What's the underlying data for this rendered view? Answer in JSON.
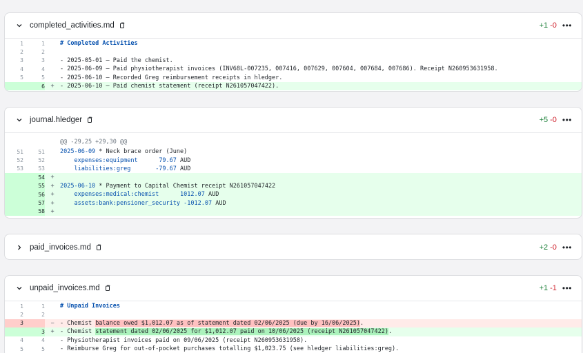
{
  "files": [
    {
      "name": "completed_activities.md",
      "additions": "+1",
      "deletions": "-0",
      "expanded": true,
      "lines": [
        {
          "old": "1",
          "new": "1",
          "sign": "",
          "type": "ctx",
          "text": "# Completed Activities"
        },
        {
          "old": "2",
          "new": "2",
          "sign": "",
          "type": "ctx",
          "text": ""
        },
        {
          "old": "3",
          "new": "3",
          "sign": "",
          "type": "ctx",
          "text": "- 2025-05-01 – Paid the chemist."
        },
        {
          "old": "4",
          "new": "4",
          "sign": "",
          "type": "ctx",
          "text": "- 2025-06-09 – Paid physiotherapist invoices (INV68L-007235, 007416, 007629, 007604, 007684, 007686). Receipt N260953631958."
        },
        {
          "old": "5",
          "new": "5",
          "sign": "",
          "type": "ctx",
          "text": "- 2025-06-10 – Recorded Greg reimbursement receipts in hledger."
        },
        {
          "old": "",
          "new": "6",
          "sign": "+",
          "type": "add",
          "text": "- 2025-06-10 – Paid chemist statement (receipt N261057047422)."
        }
      ]
    },
    {
      "name": "journal.hledger",
      "additions": "+5",
      "deletions": "-0",
      "expanded": true,
      "hunk": "@@ -29,25 +29,30 @@",
      "lines": [
        {
          "old": "51",
          "new": "51",
          "sign": "",
          "type": "ctx",
          "date": "2025-06-09",
          "text": " * Neck brace order (June)"
        },
        {
          "old": "52",
          "new": "52",
          "sign": "",
          "type": "ctx",
          "acct": "    expenses:equipment",
          "amount": "79.67",
          "unit": "AUD",
          "pad": "      "
        },
        {
          "old": "53",
          "new": "53",
          "sign": "",
          "type": "ctx",
          "acct": "    liabilities:greg",
          "amount": "-79.67",
          "unit": "AUD",
          "pad": "       "
        },
        {
          "old": "",
          "new": "54",
          "sign": "+",
          "type": "add",
          "text": ""
        },
        {
          "old": "",
          "new": "55",
          "sign": "+",
          "type": "add",
          "date": "2025-06-10",
          "text": " * Payment to Capital Chemist receipt N261057047422"
        },
        {
          "old": "",
          "new": "56",
          "sign": "+",
          "type": "add",
          "acct": "    expenses:medical:chemist",
          "amount": "1012.07",
          "unit": "AUD",
          "pad": "      "
        },
        {
          "old": "",
          "new": "57",
          "sign": "+",
          "type": "add",
          "acct": "    assets:bank:pensioner_security",
          "amount": "-1012.07",
          "unit": "AUD",
          "pad": " "
        },
        {
          "old": "",
          "new": "58",
          "sign": "+",
          "type": "add",
          "text": ""
        }
      ]
    },
    {
      "name": "paid_invoices.md",
      "additions": "+2",
      "deletions": "-0",
      "expanded": false
    },
    {
      "name": "unpaid_invoices.md",
      "additions": "+1",
      "deletions": "-1",
      "expanded": true,
      "lines": [
        {
          "old": "1",
          "new": "1",
          "sign": "",
          "type": "ctx",
          "text": "# Unpaid Invoices"
        },
        {
          "old": "2",
          "new": "2",
          "sign": "",
          "type": "ctx",
          "text": ""
        },
        {
          "old": "3",
          "new": "",
          "sign": "−",
          "type": "del",
          "pre": "- Chemist ",
          "hl": "balance owed $1,012.07 as of statement dated 02/06/2025 (due by 16/06/2025)",
          "post": "."
        },
        {
          "old": "",
          "new": "3",
          "sign": "+",
          "type": "add",
          "pre": "- Chemist ",
          "hl": "statement dated 02/06/2025 for $1,012.07 paid on 10/06/2025 (receipt N261057047422)",
          "post": "."
        },
        {
          "old": "4",
          "new": "4",
          "sign": "",
          "type": "ctx",
          "text": "- Physiotherapist invoices paid on 09/06/2025 (receipt N260953631958)."
        },
        {
          "old": "5",
          "new": "5",
          "sign": "",
          "type": "ctx",
          "text": "- Reimburse Greg for out-of-pocket purchases totalling $1,023.75 (see hledger liabilities:greg)."
        }
      ]
    }
  ],
  "icons": {
    "expand": "chevron-down-icon",
    "collapse": "chevron-right-icon",
    "copy": "copy-icon",
    "more": "more-icon"
  },
  "colors": {
    "add": "#1a7f37",
    "del": "#cf222e",
    "add_bg": "#e6ffec",
    "del_bg": "#ffebe9"
  }
}
